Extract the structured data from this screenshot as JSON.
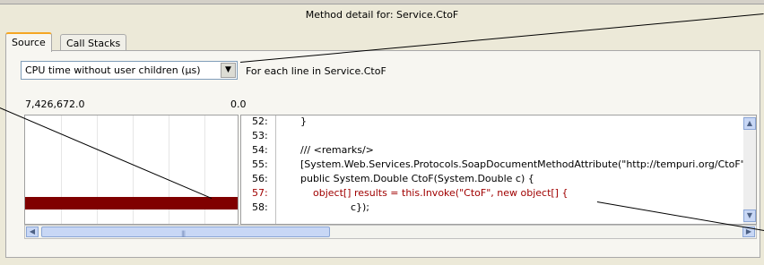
{
  "window": {
    "title": "Method detail for: Service.CtoF"
  },
  "tabs": [
    {
      "label": "Source",
      "active": true
    },
    {
      "label": "Call Stacks",
      "active": false
    }
  ],
  "metric": {
    "selected": "CPU time without user children (µs)",
    "scope_label": "For each line in Service.CtoF"
  },
  "axis": {
    "max": "7,426,672.0",
    "min": "0.0"
  },
  "bar_data": {
    "highlighted_line": 57,
    "value_fraction": 1.0
  },
  "code": {
    "lines": [
      {
        "num": "52:",
        "text": "}"
      },
      {
        "num": "53:",
        "text": ""
      },
      {
        "num": "54:",
        "text": "/// <remarks/>"
      },
      {
        "num": "55:",
        "text": "[System.Web.Services.Protocols.SoapDocumentMethodAttribute(\"http://tempuri.org/CtoF\""
      },
      {
        "num": "56:",
        "text": "public System.Double CtoF(System.Double c) {"
      },
      {
        "num": "57:",
        "text": "    object[] results = this.Invoke(\"CtoF\", new object[] {"
      },
      {
        "num": "58:",
        "text": "                c});"
      }
    ]
  },
  "colors": {
    "highlight_bar": "#800000",
    "highlight_text": "#a00000",
    "tab_accent": "#f5a623"
  }
}
